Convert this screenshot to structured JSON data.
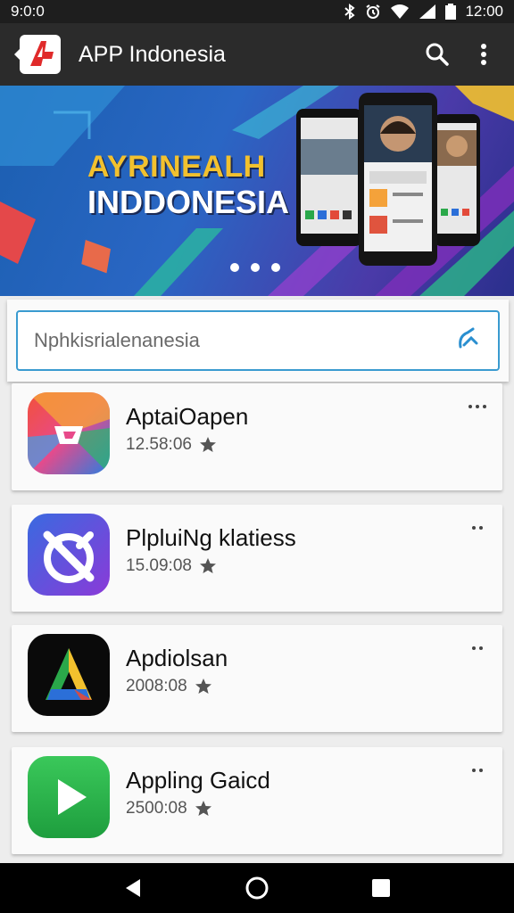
{
  "status_bar": {
    "time": "9:0:0",
    "clock": "12:00"
  },
  "app_bar": {
    "title": "APP Indonesia"
  },
  "banner": {
    "title": "AYRINEALH",
    "subtitle": "INDDONESIA",
    "slide_count": 3,
    "active_slide": 1
  },
  "search": {
    "placeholder": "Nphkisrialenanesia"
  },
  "apps": [
    {
      "name": "AptaiOapen",
      "meta": "12.58:06"
    },
    {
      "name": "PlpluiNg klatiess",
      "meta": "15.09:08"
    },
    {
      "name": "Apdiolsan",
      "meta": "2008:08"
    },
    {
      "name": "Appling Gaicd",
      "meta": "2500:08"
    }
  ],
  "colors": {
    "accent": "#3a9bd0",
    "appbar": "#2b2b2b",
    "banner_title": "#f2c12e"
  }
}
